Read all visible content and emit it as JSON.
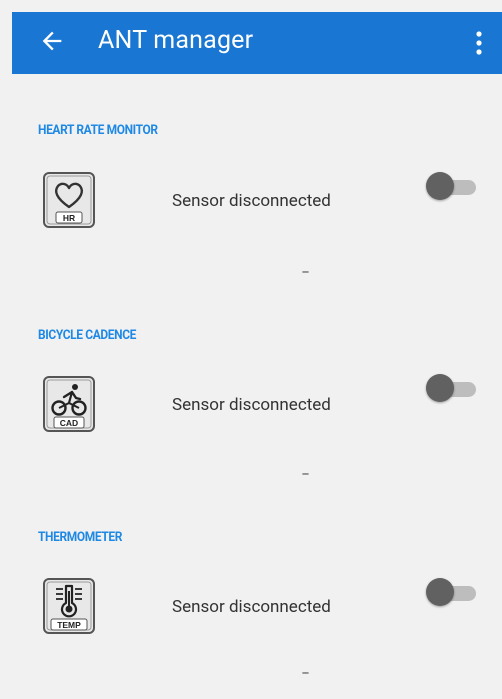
{
  "app_bar": {
    "title": "ANT manager",
    "back_icon": "arrow-back-icon",
    "menu_icon": "more-vert-icon",
    "color": "#1976d2"
  },
  "sensors": [
    {
      "header": "HEART RATE MONITOR",
      "icon": "heart-rate-icon",
      "icon_label": "HR",
      "status": "Sensor disconnected",
      "value": "--",
      "enabled": false
    },
    {
      "header": "BICYCLE CADENCE",
      "icon": "bicycle-cadence-icon",
      "icon_label": "CAD",
      "status": "Sensor disconnected",
      "value": "--",
      "enabled": false
    },
    {
      "header": "THERMOMETER",
      "icon": "thermometer-icon",
      "icon_label": "TEMP",
      "status": "Sensor disconnected",
      "value": "--",
      "enabled": false
    }
  ],
  "colors": {
    "section_header": "#1e88e5",
    "background": "#f1f1f1"
  }
}
